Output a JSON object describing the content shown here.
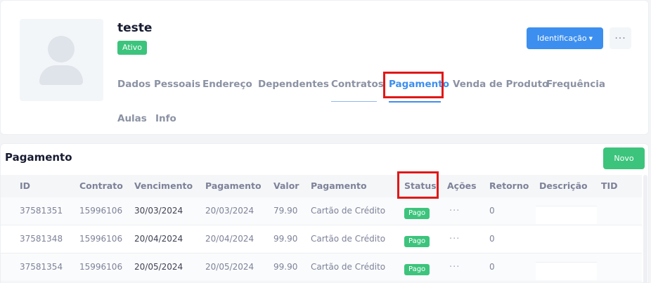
{
  "profile": {
    "name": "teste",
    "status": "Ativo",
    "identificacao_button": "Identificação",
    "more_button": "···"
  },
  "tabs": [
    {
      "label": "Dados Pessoais"
    },
    {
      "label": "Endereço"
    },
    {
      "label": "Dependentes"
    },
    {
      "label": "Contratos"
    },
    {
      "label": "Pagamento",
      "active": true
    },
    {
      "label": "Venda de Produto"
    },
    {
      "label": "Frequência"
    },
    {
      "label": "Aulas"
    },
    {
      "label": "Info"
    }
  ],
  "payment": {
    "title": "Pagamento",
    "new_button": "Novo",
    "columns": [
      "ID",
      "Contrato",
      "Vencimento",
      "Pagamento",
      "Valor",
      "Pagamento",
      "Status",
      "Ações",
      "Retorno",
      "Descrição",
      "TID"
    ],
    "rows": [
      {
        "id": "37581351",
        "contrato": "15996106",
        "vencimento": "30/03/2024",
        "pagamento": "20/03/2024",
        "valor": "79.90",
        "forma": "Cartão de Crédito",
        "status": "Pago",
        "acoes": "···",
        "retorno": "0"
      },
      {
        "id": "37581348",
        "contrato": "15996106",
        "vencimento": "20/04/2024",
        "pagamento": "20/04/2024",
        "valor": "99.90",
        "forma": "Cartão de Crédito",
        "status": "Pago",
        "acoes": "···",
        "retorno": "0"
      },
      {
        "id": "37581354",
        "contrato": "15996106",
        "vencimento": "20/05/2024",
        "pagamento": "20/05/2024",
        "valor": "99.90",
        "forma": "Cartão de Crédito",
        "status": "Pago",
        "acoes": "···",
        "retorno": "0"
      }
    ]
  },
  "colors": {
    "primary": "#3d8fef",
    "success": "#3cc47c",
    "highlight": "#e01818"
  }
}
